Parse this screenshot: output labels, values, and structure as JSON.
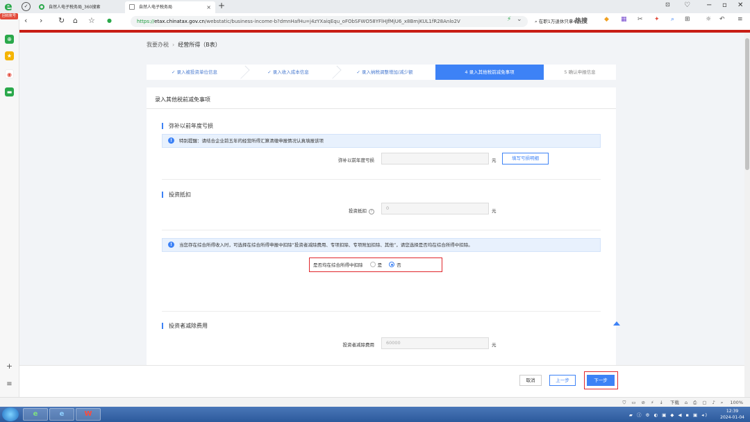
{
  "browser": {
    "badge_text": "回收账号",
    "tabs": [
      {
        "label": "自然人电子税务局_360搜索"
      },
      {
        "label": "自然人电子税务局"
      }
    ],
    "url_https": "https://",
    "url_host": "etax.chinatax.gov.cn",
    "url_rest": "/webstatic/business-income-b?dmnHafHu=j4zYXaiqEqu_oFObSFWO58YFlHJfMjU6_x8BmjKUL1fR28Anlo2V",
    "search_text": "在职1万退休只拿4千",
    "search_hot": "热搜"
  },
  "breadcrumb": {
    "root": "我要办税",
    "current": "经营所得（B表）"
  },
  "steps": [
    {
      "label": "✓ 录入被投资单位信息"
    },
    {
      "label": "✓ 录入收入成本信息"
    },
    {
      "label": "✓ 录入纳税调整增加/减少额"
    },
    {
      "label": "4  录入其他税前减免事项"
    },
    {
      "label": "5  确认申报信息"
    }
  ],
  "panel_title": "录入其他税前减免事项",
  "loss_section": {
    "title": "弥补以前年度亏损",
    "notice": "特别提醒：请结合企业前五年的经营所得汇算清缴申报情况认真填报该项",
    "label": "弥补以前年度亏损",
    "value": "",
    "unit": "元",
    "button": "填写亏损明细"
  },
  "investment_section": {
    "title": "投资抵扣",
    "label": "投资抵扣",
    "help_icon": "?",
    "value": "0",
    "unit": "元"
  },
  "comprehensive_notice": "当您存在综合所得收入时，可选择在综合所得申报中扣除“投资者减除费用、专项扣除、专项附加扣除、其他”，请您选择是否均在综合所得中扣除。",
  "comprehensive_choice": {
    "label": "是否均在综合所得中扣除",
    "options": [
      "是",
      "否"
    ],
    "selected": "否"
  },
  "investor_section": {
    "title": "投资者减除费用",
    "label": "投资者减除费用",
    "value": "60000",
    "unit": "元"
  },
  "footer": {
    "cancel": "取消",
    "prev": "上一步",
    "next": "下一步"
  },
  "statusbar": {
    "download": "下载",
    "zoom": "100%"
  },
  "clock": {
    "time": "12:39",
    "date": "2024-01-04"
  },
  "colors": {
    "accent": "#3d82f6",
    "highlight_box": "#e0262b",
    "brand_red": "#c81e15"
  }
}
